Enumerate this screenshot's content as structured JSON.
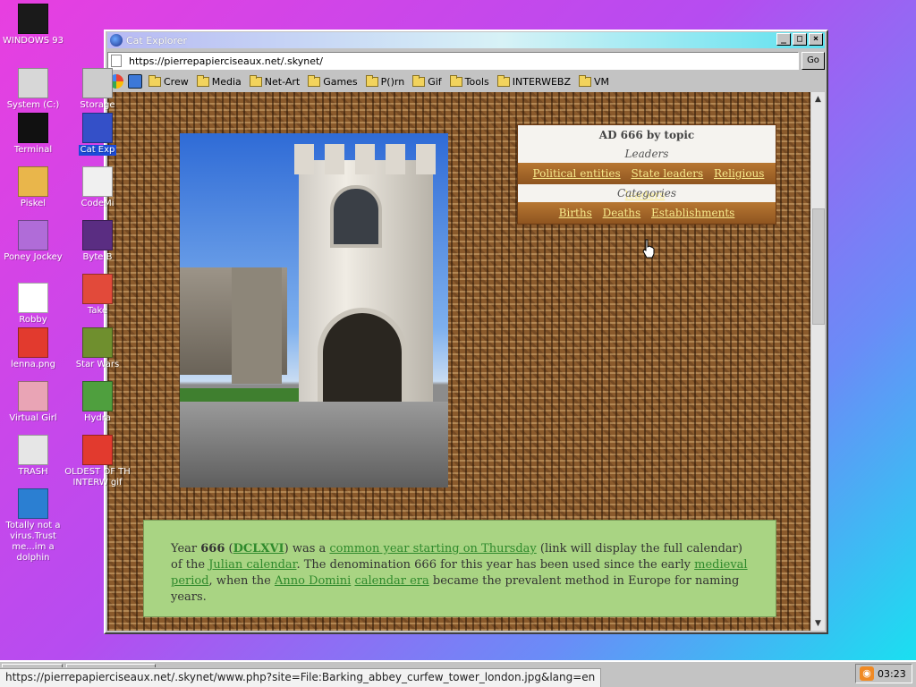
{
  "desktop": {
    "icons": [
      {
        "label": "WINDOWS 93",
        "icon": "windows93-icon",
        "color": "#1a1a1a"
      },
      {
        "label": "System (C:)",
        "icon": "drive-icon",
        "color": "#d7d7d7"
      },
      {
        "label": "Terminal",
        "icon": "terminal-icon",
        "color": "#111111"
      },
      {
        "label": "Piskel",
        "icon": "palette-icon",
        "color": "#e9b64b"
      },
      {
        "label": "Poney Jockey",
        "icon": "pony-icon",
        "color": "#b06cd8"
      },
      {
        "label": "Robby",
        "icon": "stick-figure-icon",
        "color": "#ffffff"
      },
      {
        "label": "lenna.png",
        "icon": "image-file-icon",
        "color": "#e23a2e"
      },
      {
        "label": "Virtual Girl",
        "icon": "face-icon",
        "color": "#e9a4b5"
      },
      {
        "label": "TRASH",
        "icon": "trash-icon",
        "color": "#e6e6e6"
      },
      {
        "label": "Totally not a virus.Trust me...im a dolphin",
        "icon": "dolphin-icon",
        "color": "#2b7fd2"
      },
      {
        "label": "Storage",
        "icon": "storage-icon",
        "color": "#cccccc"
      },
      {
        "label": "Cat Exp",
        "icon": "cat-explorer-icon",
        "color": "#3450c8"
      },
      {
        "label": "CodeMi",
        "icon": "code-icon",
        "color": "#f0f0f0"
      },
      {
        "label": "Byte B",
        "icon": "byte-beat-icon",
        "color": "#5a2d82"
      },
      {
        "label": "Take",
        "icon": "take-icon",
        "color": "#e24a3a"
      },
      {
        "label": "Star Wars",
        "icon": "yoda-icon",
        "color": "#6f8f2e"
      },
      {
        "label": "Hydra",
        "icon": "hydra-icon",
        "color": "#4f9f3e"
      },
      {
        "label": "OLDEST OF TH INTERW gif",
        "icon": "gif-file-icon",
        "color": "#e23a2e"
      }
    ]
  },
  "window": {
    "title": "Cat Explorer",
    "controls": {
      "minimize": "_",
      "maximize": "□",
      "close": "×"
    },
    "address": {
      "value": "https://pierrepapierciseaux.net/.skynet/",
      "go_label": "Go"
    },
    "bookmarks": [
      "Crew",
      "Media",
      "Net-Art",
      "Games",
      "P()rn",
      "Gif",
      "Tools",
      "INTERWEBZ",
      "VM"
    ]
  },
  "page": {
    "photo_caption": "",
    "topic_box": {
      "title": "AD 666 by topic",
      "leaders_heading": "Leaders",
      "leaders_links": [
        "Political entities",
        "State leaders",
        "Religious leaders"
      ],
      "categories_heading": "Categories",
      "categories_links": [
        "Births",
        "Deaths",
        "Establishments"
      ]
    },
    "article": {
      "t1": "Year ",
      "year": "666",
      "t2": " (",
      "roman": "DCLXVI",
      "t3": ") was a ",
      "link_common_year": "common year starting on Thursday",
      "t4": " (link will display the full calendar) of the ",
      "link_julian": "Julian calendar",
      "t5": ". The denomination 666 for this year has been used since the early ",
      "link_medieval": "medieval period",
      "t6": ", when the ",
      "link_anno": "Anno Domini",
      "t7": " ",
      "link_era": "calendar era",
      "t8": " became the prevalent method in Europe for naming years."
    }
  },
  "status_bar": {
    "url": "https://pierrepapierciseaux.net/.skynet/www.php?site=File:Barking_abbey_curfew_tower_london.jpg&lang=en"
  },
  "tray": {
    "clock": "03:23",
    "feed_icon": "rss-icon"
  }
}
